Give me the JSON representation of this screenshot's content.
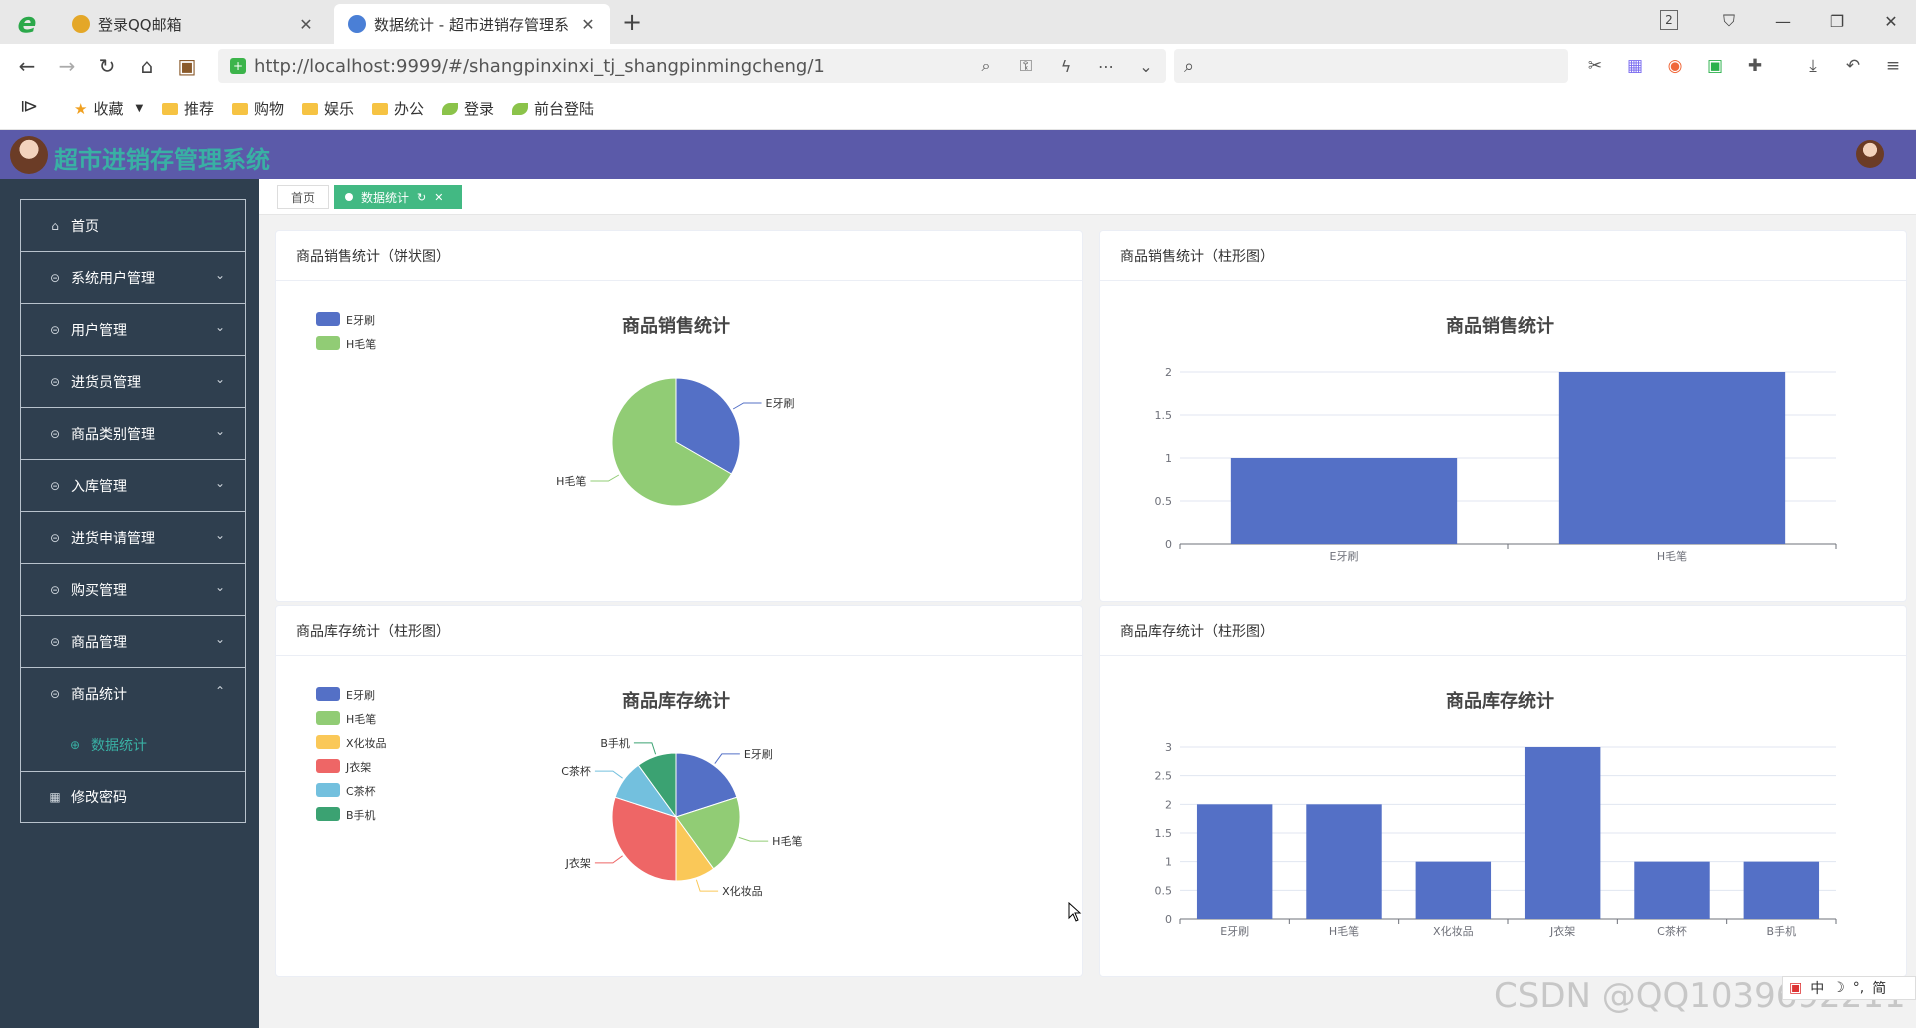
{
  "browser": {
    "tabs": [
      {
        "title": "登录QQ邮箱",
        "favicon_color": "#e4a728"
      },
      {
        "title": "数据统计 - 超市进销存管理系",
        "favicon_color": "#4a7fd6"
      }
    ],
    "window_count": "2",
    "url": "http://localhost:9999/#/shangpinxinxi_tj_shangpinmingcheng/1",
    "bookmarks": [
      "收藏",
      "推荐",
      "购物",
      "娱乐",
      "办公",
      "登录",
      "前台登陆"
    ]
  },
  "app": {
    "title": "超市进销存管理系统",
    "accent": "#5b5aa9",
    "title_color": "#39b0a4"
  },
  "sidebar": {
    "items": [
      {
        "label": "首页",
        "icon": "home-icon"
      },
      {
        "label": "系统用户管理",
        "icon": "circle-icon"
      },
      {
        "label": "用户管理",
        "icon": "circle-icon"
      },
      {
        "label": "进货员管理",
        "icon": "circle-icon"
      },
      {
        "label": "商品类别管理",
        "icon": "circle-icon"
      },
      {
        "label": "入库管理",
        "icon": "circle-icon"
      },
      {
        "label": "进货申请管理",
        "icon": "circle-icon"
      },
      {
        "label": "购买管理",
        "icon": "circle-icon"
      },
      {
        "label": "商品管理",
        "icon": "circle-icon"
      },
      {
        "label": "商品统计",
        "icon": "circle-icon"
      },
      {
        "label": "数据统计",
        "icon": "plus-circle-icon"
      },
      {
        "label": "修改密码",
        "icon": "grid-icon"
      }
    ]
  },
  "tags": {
    "home": "首页",
    "active": "数据统计"
  },
  "cards": [
    {
      "header": "商品销售统计（饼状图）"
    },
    {
      "header": "商品销售统计（柱形图）"
    },
    {
      "header": "商品库存统计（柱形图）"
    },
    {
      "header": "商品库存统计（柱形图）"
    }
  ],
  "chart_data": [
    {
      "type": "pie",
      "title": "商品销售统计",
      "legend": "top-left",
      "categories": [
        "E牙刷",
        "H毛笔"
      ],
      "values": [
        1,
        2
      ],
      "colors": [
        "#5470c6",
        "#91cc75"
      ]
    },
    {
      "type": "bar",
      "title": "商品销售统计",
      "categories": [
        "E牙刷",
        "H毛笔"
      ],
      "values": [
        1,
        2
      ],
      "ylim": [
        0,
        2
      ],
      "yticks": [
        "0",
        "0.5",
        "1",
        "1.5",
        "2"
      ],
      "grid": true,
      "color": "#5470c6"
    },
    {
      "type": "pie",
      "title": "商品库存统计",
      "legend": "top-left",
      "categories": [
        "E牙刷",
        "H毛笔",
        "X化妆品",
        "J衣架",
        "C茶杯",
        "B手机"
      ],
      "values": [
        2,
        2,
        1,
        3,
        1,
        1
      ],
      "colors": [
        "#5470c6",
        "#91cc75",
        "#fac858",
        "#ee6666",
        "#73c0de",
        "#3ba272"
      ]
    },
    {
      "type": "bar",
      "title": "商品库存统计",
      "categories": [
        "E牙刷",
        "H毛笔",
        "X化妆品",
        "J衣架",
        "C茶杯",
        "B手机"
      ],
      "values": [
        2,
        2,
        1,
        3,
        1,
        1
      ],
      "ylim": [
        0,
        3
      ],
      "yticks": [
        "0",
        "0.5",
        "1",
        "1.5",
        "2",
        "2.5",
        "3"
      ],
      "grid": true,
      "color": "#5470c6"
    }
  ],
  "watermark": "CSDN @QQ1039692211",
  "ime": [
    "中",
    "简"
  ]
}
